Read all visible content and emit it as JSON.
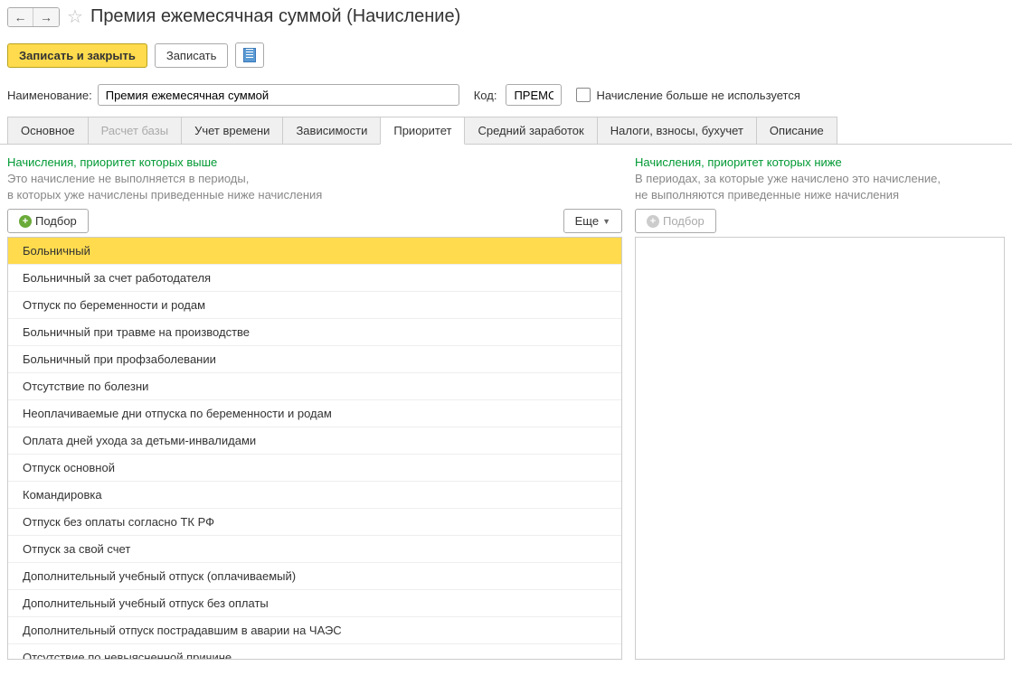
{
  "header": {
    "title": "Премия ежемесячная суммой (Начисление)"
  },
  "toolbar": {
    "save_close_label": "Записать и закрыть",
    "save_label": "Записать"
  },
  "form": {
    "name_label": "Наименование:",
    "name_value": "Премия ежемесячная суммой",
    "code_label": "Код:",
    "code_value": "ПРЕМС",
    "unused_label": "Начисление больше не используется"
  },
  "tabs": [
    {
      "label": "Основное",
      "active": false
    },
    {
      "label": "Расчет базы",
      "active": false,
      "disabled": true
    },
    {
      "label": "Учет времени",
      "active": false
    },
    {
      "label": "Зависимости",
      "active": false
    },
    {
      "label": "Приоритет",
      "active": true
    },
    {
      "label": "Средний заработок",
      "active": false
    },
    {
      "label": "Налоги, взносы, бухучет",
      "active": false
    },
    {
      "label": "Описание",
      "active": false
    }
  ],
  "panels": {
    "higher": {
      "title": "Начисления, приоритет которых выше",
      "desc1": "Это начисление не выполняется в периоды,",
      "desc2": "в которых уже начислены приведенные ниже начисления",
      "pick_label": "Подбор",
      "more_label": "Еще",
      "items": [
        "Больничный",
        "Больничный за счет работодателя",
        "Отпуск по беременности и родам",
        "Больничный при травме на производстве",
        "Больничный при профзаболевании",
        "Отсутствие по болезни",
        "Неоплачиваемые дни отпуска по беременности и родам",
        "Оплата дней ухода за детьми-инвалидами",
        "Отпуск основной",
        "Командировка",
        "Отпуск без оплаты согласно ТК РФ",
        "Отпуск за свой счет",
        "Дополнительный учебный отпуск (оплачиваемый)",
        "Дополнительный учебный отпуск без оплаты",
        "Дополнительный отпуск пострадавшим в аварии на ЧАЭС",
        "Отсутствие по невыясненной причине"
      ]
    },
    "lower": {
      "title": "Начисления, приоритет которых ниже",
      "desc1": "В периодах, за которые уже начислено это начисление,",
      "desc2": "не выполняются приведенные ниже начисления",
      "pick_label": "Подбор"
    }
  }
}
